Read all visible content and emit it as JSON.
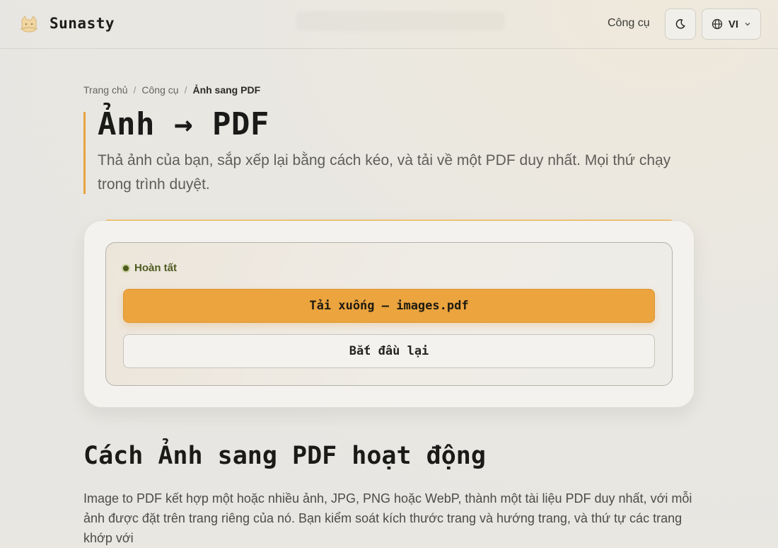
{
  "header": {
    "brand": "Sunasty",
    "nav_tools": "Công cụ",
    "lang_label": "VI"
  },
  "icons": {
    "logo": "cat-logo-icon",
    "theme": "moon-icon",
    "lang": "globe-icon",
    "lang_caret": "chevron-down-icon"
  },
  "breadcrumb": {
    "home": "Trang chủ",
    "tools": "Công cụ",
    "current": "Ảnh sang PDF",
    "separator": "/"
  },
  "page": {
    "title": "Ảnh → PDF",
    "subtitle": "Thả ảnh của bạn, sắp xếp lại bằng cách kéo, và tải về một PDF duy nhất. Mọi thứ chạy trong trình duyệt."
  },
  "result": {
    "status": "Hoàn tất",
    "download_label": "Tải xuống — images.pdf",
    "restart_label": "Bắt đầu lại"
  },
  "section": {
    "title": "Cách Ảnh sang PDF hoạt động",
    "body": "Image to PDF kết hợp một hoặc nhiều ảnh, JPG, PNG hoặc WebP, thành một tài liệu PDF duy nhất, với mỗi ảnh được đặt trên trang riêng của nó. Bạn kiểm soát kích thước trang và hướng trang, và thứ tự các trang khớp với"
  },
  "colors": {
    "accent": "#eba43e",
    "status": "#4f5b20",
    "background": "#e9e7e2"
  }
}
